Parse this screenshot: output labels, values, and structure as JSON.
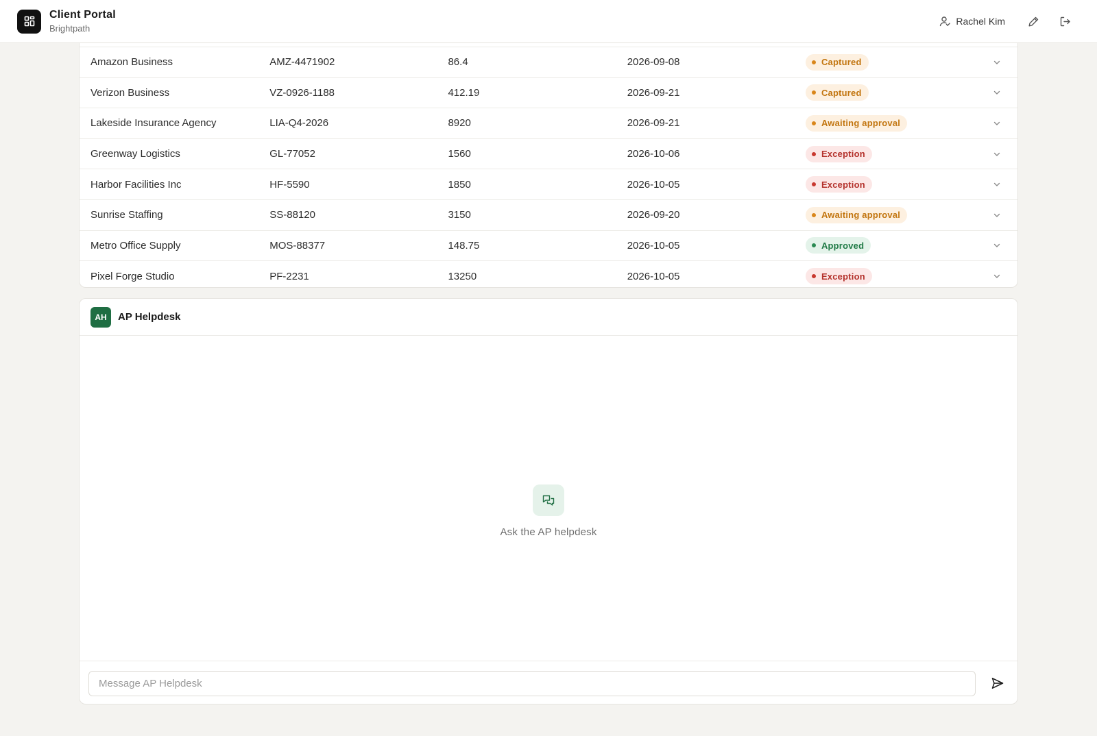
{
  "header": {
    "app_title": "Client Portal",
    "org_name": "Brightpath",
    "user_name": "Rachel Kim",
    "icons": {
      "logo": "dashboard-grid-icon",
      "user": "user-icon",
      "edit": "pencil-icon",
      "logout": "logout-icon"
    }
  },
  "invoices": {
    "rows": [
      {
        "vendor": "Amazon Business",
        "invoice": "AMZ-4471902",
        "amount": "86.4",
        "date": "2026-09-08",
        "status": "Captured",
        "status_kind": "captured"
      },
      {
        "vendor": "Verizon Business",
        "invoice": "VZ-0926-1188",
        "amount": "412.19",
        "date": "2026-09-21",
        "status": "Captured",
        "status_kind": "captured"
      },
      {
        "vendor": "Lakeside Insurance Agency",
        "invoice": "LIA-Q4-2026",
        "amount": "8920",
        "date": "2026-09-21",
        "status": "Awaiting approval",
        "status_kind": "awaiting"
      },
      {
        "vendor": "Greenway Logistics",
        "invoice": "GL-77052",
        "amount": "1560",
        "date": "2026-10-06",
        "status": "Exception",
        "status_kind": "exception"
      },
      {
        "vendor": "Harbor Facilities Inc",
        "invoice": "HF-5590",
        "amount": "1850",
        "date": "2026-10-05",
        "status": "Exception",
        "status_kind": "exception"
      },
      {
        "vendor": "Sunrise Staffing",
        "invoice": "SS-88120",
        "amount": "3150",
        "date": "2026-09-20",
        "status": "Awaiting approval",
        "status_kind": "awaiting"
      },
      {
        "vendor": "Metro Office Supply",
        "invoice": "MOS-88377",
        "amount": "148.75",
        "date": "2026-10-05",
        "status": "Approved",
        "status_kind": "approved"
      },
      {
        "vendor": "Pixel Forge Studio",
        "invoice": "PF-2231",
        "amount": "13250",
        "date": "2026-10-05",
        "status": "Exception",
        "status_kind": "exception"
      }
    ],
    "row_action_icon": "chevron-down-icon"
  },
  "chat": {
    "avatar_initials": "AH",
    "title": "AP Helpdesk",
    "empty_icon": "chat-bubbles-icon",
    "empty_text": "Ask the AP helpdesk",
    "input_placeholder": "Message AP Helpdesk",
    "input_value": "",
    "send_icon": "send-icon"
  },
  "colors": {
    "background": "#f4f3f0",
    "avatar": "#1f6e43",
    "captured": "#c2750f",
    "exception": "#b4322c",
    "approved": "#1f7a45"
  }
}
